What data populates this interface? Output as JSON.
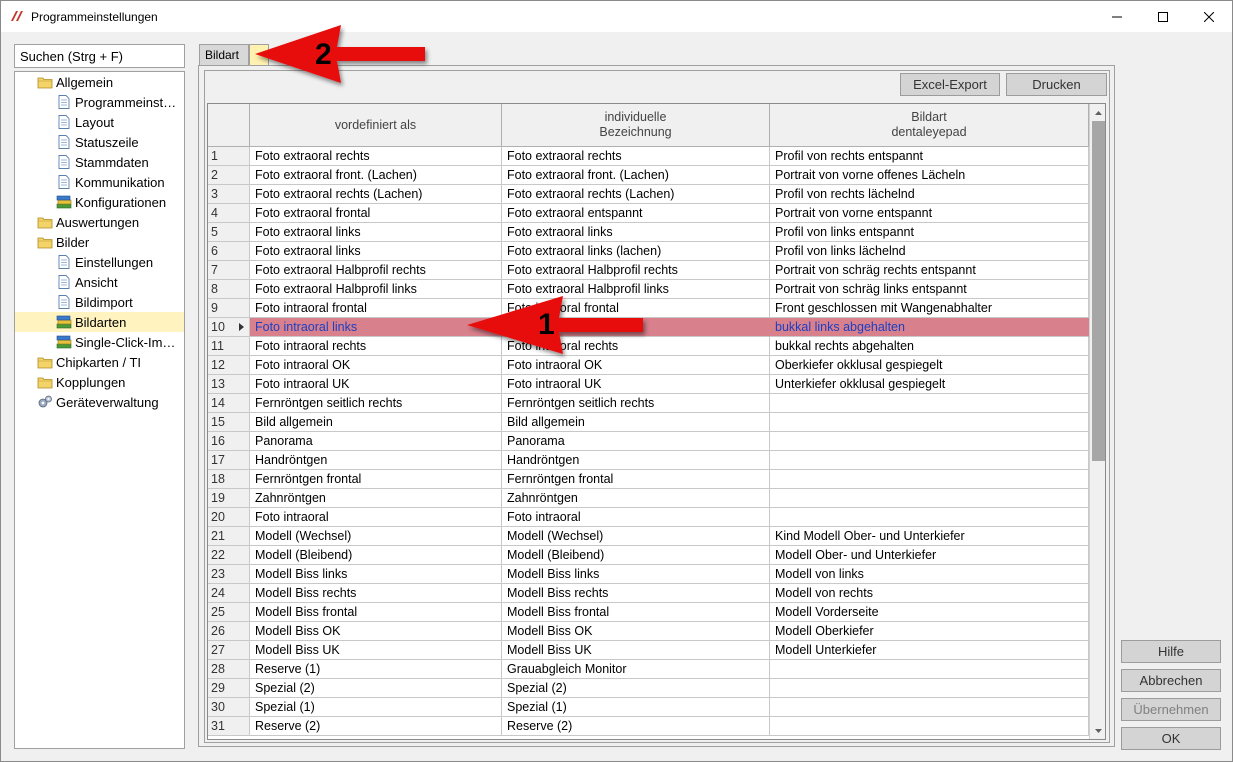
{
  "window": {
    "title": "Programmeinstellungen"
  },
  "search": {
    "placeholder": "Suchen (Strg + F)"
  },
  "tree": [
    {
      "label": "Allgemein",
      "icon": "folder-icon",
      "level": 0
    },
    {
      "label": "Programmeinst…",
      "icon": "document-icon",
      "level": 1
    },
    {
      "label": "Layout",
      "icon": "document-icon",
      "level": 1
    },
    {
      "label": "Statuszeile",
      "icon": "document-icon",
      "level": 1
    },
    {
      "label": "Stammdaten",
      "icon": "document-icon",
      "level": 1
    },
    {
      "label": "Kommunikation",
      "icon": "document-icon",
      "level": 1
    },
    {
      "label": "Konfigurationen",
      "icon": "books-icon",
      "level": 1
    },
    {
      "label": "Auswertungen",
      "icon": "folder-icon",
      "level": 0
    },
    {
      "label": "Bilder",
      "icon": "folder-icon",
      "level": 0
    },
    {
      "label": "Einstellungen",
      "icon": "document-icon",
      "level": 1
    },
    {
      "label": "Ansicht",
      "icon": "document-icon",
      "level": 1
    },
    {
      "label": "Bildimport",
      "icon": "document-icon",
      "level": 1
    },
    {
      "label": "Bildarten",
      "icon": "books-icon",
      "level": 1,
      "selected": true
    },
    {
      "label": "Single-Click-Im…",
      "icon": "books-icon",
      "level": 1
    },
    {
      "label": "Chipkarten / TI",
      "icon": "folder-icon",
      "level": 0
    },
    {
      "label": "Kopplungen",
      "icon": "folder-icon",
      "level": 0
    },
    {
      "label": "Geräteverwaltung",
      "icon": "gears-icon",
      "level": 0
    }
  ],
  "tabs": [
    {
      "label": "Bildart"
    },
    {
      "label": ""
    }
  ],
  "toolbar": {
    "excel_label": "Excel-Export",
    "print_label": "Drucken"
  },
  "grid": {
    "columns": [
      "",
      "vordefiniert als",
      "individuelle\nBezeichnung",
      "Bildart\ndentaleyepad"
    ],
    "rows": [
      [
        "1",
        "Foto extraoral rechts",
        "Foto extraoral rechts",
        "Profil von rechts entspannt"
      ],
      [
        "2",
        "Foto extraoral front. (Lachen)",
        "Foto extraoral front. (Lachen)",
        "Portrait von vorne offenes Lächeln"
      ],
      [
        "3",
        "Foto extraoral rechts (Lachen)",
        "Foto extraoral rechts (Lachen)",
        "Profil von rechts lächelnd"
      ],
      [
        "4",
        "Foto extraoral frontal",
        "Foto extraoral entspannt",
        "Portrait von vorne entspannt"
      ],
      [
        "5",
        "Foto extraoral links",
        "Foto extraoral links",
        "Profil von links entspannt"
      ],
      [
        "6",
        "Foto extraoral links",
        "Foto extraoral links (lachen)",
        "Profil von links lächelnd"
      ],
      [
        "7",
        "Foto extraoral Halbprofil rechts",
        "Foto extraoral Halbprofil rechts",
        "Portrait von schräg rechts entspannt"
      ],
      [
        "8",
        "Foto extraoral Halbprofil links",
        "Foto extraoral Halbprofil links",
        "Portrait von schräg links entspannt"
      ],
      [
        "9",
        "Foto intraoral frontal",
        "Foto intraoral frontal",
        "Front geschlossen mit Wangenabhalter"
      ],
      [
        "10",
        "Foto intraoral links",
        "Foto intraoral links",
        "bukkal links abgehalten"
      ],
      [
        "11",
        "Foto intraoral rechts",
        "Foto intraoral rechts",
        "bukkal rechts abgehalten"
      ],
      [
        "12",
        "Foto intraoral OK",
        "Foto intraoral OK",
        "Oberkiefer okklusal gespiegelt"
      ],
      [
        "13",
        "Foto intraoral UK",
        "Foto intraoral UK",
        "Unterkiefer okklusal gespiegelt"
      ],
      [
        "14",
        "Fernröntgen seitlich rechts",
        "Fernröntgen seitlich rechts",
        ""
      ],
      [
        "15",
        "Bild allgemein",
        "Bild allgemein",
        ""
      ],
      [
        "16",
        "Panorama",
        "Panorama",
        ""
      ],
      [
        "17",
        "Handröntgen",
        "Handröntgen",
        ""
      ],
      [
        "18",
        "Fernröntgen frontal",
        "Fernröntgen frontal",
        ""
      ],
      [
        "19",
        "Zahnröntgen",
        "Zahnröntgen",
        ""
      ],
      [
        "20",
        "Foto intraoral",
        "Foto intraoral",
        ""
      ],
      [
        "21",
        "Modell (Wechsel)",
        "Modell (Wechsel)",
        "Kind Modell Ober- und Unterkiefer"
      ],
      [
        "22",
        "Modell (Bleibend)",
        "Modell (Bleibend)",
        "Modell Ober- und Unterkiefer"
      ],
      [
        "23",
        "Modell Biss links",
        "Modell Biss links",
        "Modell von links"
      ],
      [
        "24",
        "Modell Biss rechts",
        "Modell Biss rechts",
        "Modell von rechts"
      ],
      [
        "25",
        "Modell Biss frontal",
        "Modell Biss frontal",
        "Modell Vorderseite"
      ],
      [
        "26",
        "Modell Biss OK",
        "Modell Biss OK",
        "Modell Oberkiefer"
      ],
      [
        "27",
        "Modell Biss UK",
        "Modell Biss UK",
        "Modell Unterkiefer"
      ],
      [
        "28",
        "Reserve (1)",
        "Grauabgleich Monitor",
        ""
      ],
      [
        "29",
        "Spezial (2)",
        "Spezial (2)",
        ""
      ],
      [
        "30",
        "Spezial (1)",
        "Spezial (1)",
        ""
      ],
      [
        "31",
        "Reserve (2)",
        "Reserve (2)",
        ""
      ]
    ],
    "selected_row": 9
  },
  "buttons": {
    "help": "Hilfe",
    "cancel": "Abbrechen",
    "apply": "Übernehmen",
    "ok": "OK"
  },
  "annotations": {
    "arrow1_label": "1",
    "arrow2_label": "2",
    "arrow_color": "#e81010"
  }
}
